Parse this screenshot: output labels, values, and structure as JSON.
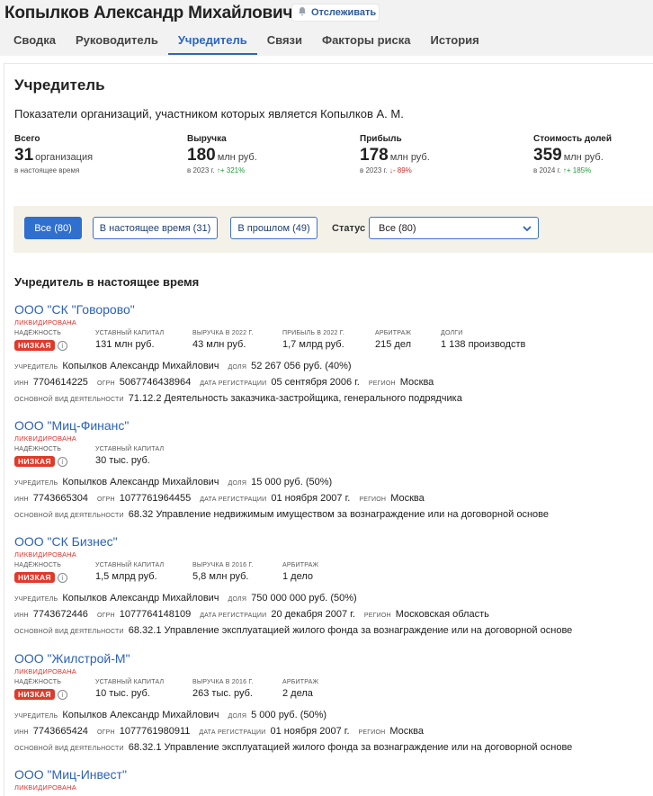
{
  "header": {
    "person_name": "Копылков Александр Михайлович",
    "follow_label": "Отслеживать",
    "tabs": [
      {
        "label": "Сводка"
      },
      {
        "label": "Руководитель"
      },
      {
        "label": "Учредитель"
      },
      {
        "label": "Связи"
      },
      {
        "label": "Факторы риска"
      },
      {
        "label": "История"
      }
    ],
    "active_tab": "Учредитель"
  },
  "section": {
    "title": "Учредитель",
    "subheading": "Показатели организаций, участником которых является Копылков А. М."
  },
  "stats": {
    "total": {
      "label": "Всего",
      "value": "31",
      "unit": "организация",
      "note": "в настоящее время"
    },
    "revenue": {
      "label": "Выручка",
      "value": "180",
      "unit": "млн руб.",
      "note": "в 2023 г.",
      "change": "+ 321%"
    },
    "profit": {
      "label": "Прибыль",
      "value": "178",
      "unit": "млн руб.",
      "note": "в 2023 г.",
      "change": "- 89%"
    },
    "shares": {
      "label": "Стоимость долей",
      "value": "359",
      "unit": "млн руб.",
      "note": "в 2024 г.",
      "change": "+ 185%"
    }
  },
  "filters": {
    "all": "Все (80)",
    "current": "В настоящее время (31)",
    "past": "В прошлом (49)",
    "status_label": "Статус",
    "status_value": "Все (80)"
  },
  "list_title": "Учредитель в настоящее время",
  "labels": {
    "reliability": "Надёжность",
    "capital": "Уставный капитал",
    "arbitration": "Арбитраж",
    "debts": "Долги",
    "founder": "Учредитель",
    "share": "Доля",
    "inn": "ИНН",
    "ogrn": "ОГРН",
    "reg_date": "Дата регистрации",
    "region": "Регион",
    "activity": "Основной вид деятельности"
  },
  "companies": [
    {
      "name": "ООО \"СК \"Говорово\"",
      "status": "ЛИКВИДИРОВАНА",
      "risk": "НИЗКАЯ",
      "capital": "131 млн руб.",
      "revenue_label": "Выручка в 2022 г.",
      "revenue": "43 млн руб.",
      "profit_label": "Прибыль в 2022 г.",
      "profit": "1,7 млрд руб.",
      "arbitration": "215 дел",
      "debts": "1 138 производств",
      "founder": "Копылков Александр Михайлович",
      "share": "52 267 056 руб. (40%)",
      "inn": "7704614225",
      "ogrn": "5067746438964",
      "reg_date": "05 сентября 2006 г.",
      "region": "Москва",
      "activity": "71.12.2 Деятельность заказчика-застройщика, генерального подрядчика"
    },
    {
      "name": "ООО \"Миц-Финанс\"",
      "status": "ЛИКВИДИРОВАНА",
      "risk": "НИЗКАЯ",
      "capital": "30 тыс. руб.",
      "founder": "Копылков Александр Михайлович",
      "share": "15 000 руб. (50%)",
      "inn": "7743665304",
      "ogrn": "1077761964455",
      "reg_date": "01 ноября 2007 г.",
      "region": "Москва",
      "activity": "68.32 Управление недвижимым имуществом за вознаграждение или на договорной основе"
    },
    {
      "name": "ООО \"СК Бизнес\"",
      "status": "ЛИКВИДИРОВАНА",
      "risk": "НИЗКАЯ",
      "capital": "1,5 млрд руб.",
      "revenue_label": "Выручка в 2016 г.",
      "revenue": "5,8 млн руб.",
      "arbitration": "1 дело",
      "founder": "Копылков Александр Михайлович",
      "share": "750 000 000 руб. (50%)",
      "inn": "7743672446",
      "ogrn": "1077764148109",
      "reg_date": "20 декабря 2007 г.",
      "region": "Московская область",
      "activity": "68.32.1 Управление эксплуатацией жилого фонда за вознаграждение или на договорной основе"
    },
    {
      "name": "ООО \"Жилстрой-М\"",
      "status": "ЛИКВИДИРОВАНА",
      "risk": "НИЗКАЯ",
      "capital": "10 тыс. руб.",
      "revenue_label": "Выручка в 2016 г.",
      "revenue": "263 тыс. руб.",
      "arbitration": "2 дела",
      "founder": "Копылков Александр Михайлович",
      "share": "5 000 руб. (50%)",
      "inn": "7743665424",
      "ogrn": "1077761980911",
      "reg_date": "01 ноября 2007 г.",
      "region": "Москва",
      "activity": "68.32.1 Управление эксплуатацией жилого фонда за вознаграждение или на договорной основе"
    },
    {
      "name": "ООО \"Миц-Инвест\"",
      "status": "ЛИКВИДИРОВАНА"
    }
  ],
  "colors": {
    "accent": "#2e6fcf",
    "link": "#2c62b8",
    "risk": "#e03a2a",
    "up": "#1e9a3a",
    "down": "#d22b2b",
    "filter_bg": "#f4f1e8"
  }
}
